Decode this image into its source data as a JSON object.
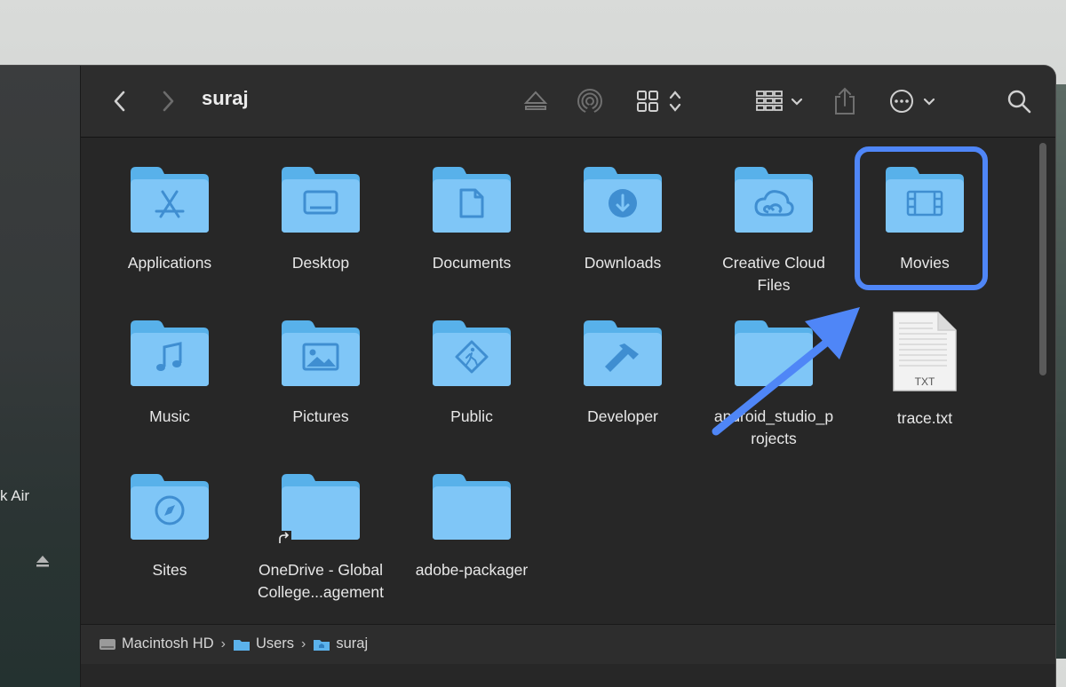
{
  "window": {
    "title": "suraj"
  },
  "sidebar": {
    "device_label": "k Air"
  },
  "toolbar": {
    "back_icon": "chevron-left-icon",
    "forward_icon": "chevron-right-icon",
    "eject_icon": "eject-icon",
    "airdrop_icon": "airdrop-icon",
    "view_icon": "icon-grid-view-icon",
    "group_icon": "group-by-icon",
    "share_icon": "share-icon",
    "more_icon": "ellipsis-circle-icon",
    "search_icon": "search-icon"
  },
  "items": [
    {
      "label": "Applications",
      "glyph": "appstore"
    },
    {
      "label": "Desktop",
      "glyph": "desktop"
    },
    {
      "label": "Documents",
      "glyph": "document"
    },
    {
      "label": "Downloads",
      "glyph": "download"
    },
    {
      "label": "Creative Cloud Files",
      "glyph": "cc"
    },
    {
      "label": "Movies",
      "glyph": "film"
    },
    {
      "label": "Music",
      "glyph": "music"
    },
    {
      "label": "Pictures",
      "glyph": "photo"
    },
    {
      "label": "Public",
      "glyph": "public"
    },
    {
      "label": "Developer",
      "glyph": "hammer"
    },
    {
      "label": "android_studio_projects",
      "glyph": "none"
    },
    {
      "label": "trace.txt",
      "glyph": "txt",
      "file_badge": "TXT"
    },
    {
      "label": "Sites",
      "glyph": "compass"
    },
    {
      "label": "OneDrive - Global College...agement",
      "glyph": "alias"
    },
    {
      "label": "adobe-packager",
      "glyph": "none"
    }
  ],
  "labels": {
    "i0": "Applications",
    "i1": "Desktop",
    "i2": "Documents",
    "i3": "Downloads",
    "i4a": "Creative Cloud",
    "i4b": "Files",
    "i5": "Movies",
    "i6": "Music",
    "i7": "Pictures",
    "i8": "Public",
    "i9": "Developer",
    "i10a": "android_studio_p",
    "i10b": "rojects",
    "i11": "trace.txt",
    "i11badge": "TXT",
    "i12": "Sites",
    "i13a": "OneDrive - Global",
    "i13b": "College...agement",
    "i14": "adobe-packager"
  },
  "path_bar": [
    "Macintosh HD",
    "Users",
    "suraj"
  ],
  "colors": {
    "folder_back": "#58b1ea",
    "folder_front": "#7fc6f7",
    "glyph": "#3f8ed1",
    "highlight": "#4f86f7",
    "arrow": "#4f86f7"
  }
}
